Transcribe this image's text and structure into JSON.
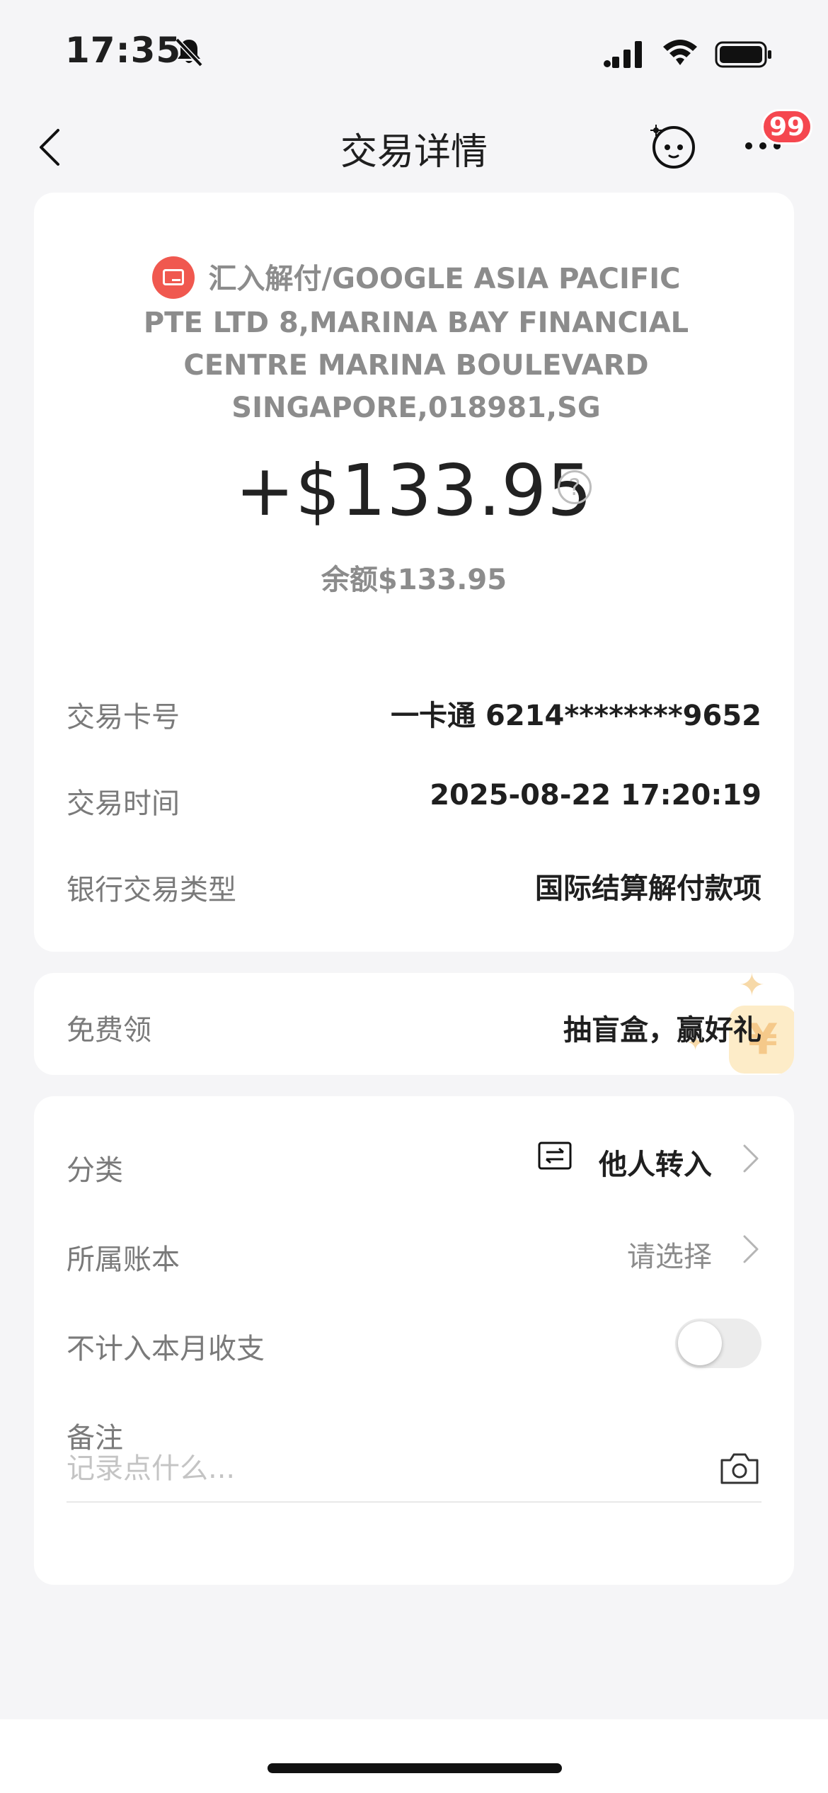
{
  "status_bar": {
    "time": "17:35",
    "icons": [
      "bell-muted-icon",
      "cellular-signal-icon",
      "wifi-icon",
      "battery-icon"
    ]
  },
  "nav": {
    "title": "交易详情",
    "back_icon": "chevron-left-icon",
    "assistant_icon": "robot-face-icon",
    "more_icon": "more-dots-icon",
    "badge": "99"
  },
  "transaction": {
    "merchant_icon": "card-icon",
    "merchant": "汇入解付/GOOGLE ASIA PACIFIC PTE LTD 8,MARINA BAY FINANCIAL CENTRE MARINA BOULEVARD SINGAPORE,018981,SG",
    "amount": "+$133.95",
    "help_icon": "?",
    "balance": "余额$133.95",
    "details": [
      {
        "label": "交易卡号",
        "value": "一卡通 6214********9652"
      },
      {
        "label": "交易时间",
        "value": "2025-08-22 17:20:19"
      },
      {
        "label": "银行交易类型",
        "value": "国际结算解付款项"
      }
    ]
  },
  "promo": {
    "label": "免费领",
    "value": "抽盲盒，赢好礼",
    "coin_glyph": "¥"
  },
  "settings": {
    "category": {
      "label": "分类",
      "value": "他人转入",
      "icon": "transfer-icon"
    },
    "ledger": {
      "label": "所属账本",
      "value": "请选择"
    },
    "exclude": {
      "label": "不计入本月收支",
      "enabled": false
    },
    "note": {
      "label": "备注",
      "placeholder": "记录点什么..."
    }
  },
  "colors": {
    "accent_red": "#f0584f",
    "badge_red": "#f5474f",
    "background": "#f5f5f7"
  }
}
